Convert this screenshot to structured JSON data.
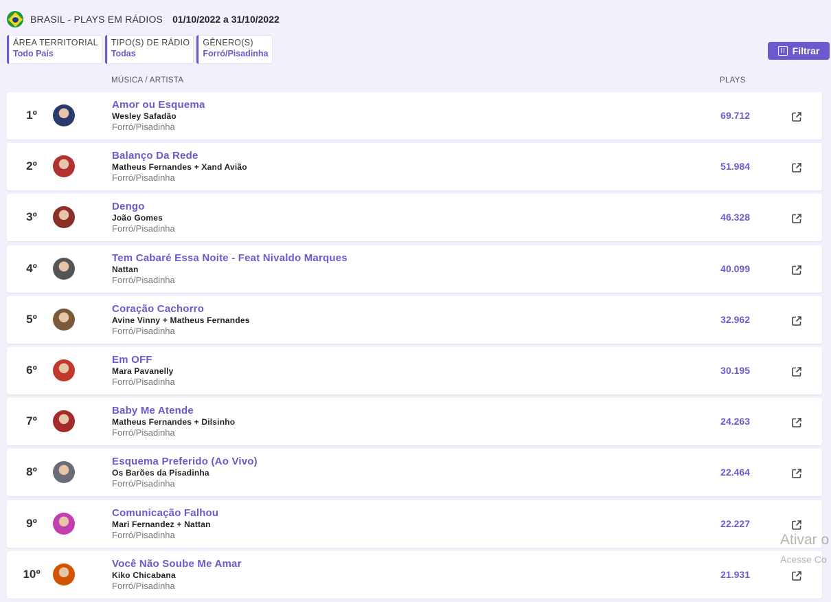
{
  "header": {
    "title": "BRASIL - PLAYS EM RÁDIOS",
    "date_range": "01/10/2022 a 31/10/2022",
    "flag_icon": "brazil-flag-icon"
  },
  "filters": [
    {
      "label": "ÁREA TERRITORIAL",
      "value": "Todo País"
    },
    {
      "label": "TIPO(S) DE RÁDIO",
      "value": "Todas"
    },
    {
      "label": "GÊNERO(S)",
      "value": "Forró/Pisadinha"
    }
  ],
  "filter_button": {
    "label": "Filtrar",
    "icon": "filter-icon"
  },
  "columns": {
    "music": "MÚSICA / ARTISTA",
    "plays": "PLAYS"
  },
  "colors": {
    "accent": "#6a5acd",
    "background": "#f3f0fb"
  },
  "rows": [
    {
      "rank": "1º",
      "song": "Amor ou Esquema",
      "artist": "Wesley Safadão",
      "genre": "Forró/Pisadinha",
      "plays": "69.712",
      "avatar_color": "#2a3a6b"
    },
    {
      "rank": "2º",
      "song": "Balanço Da Rede",
      "artist": "Matheus Fernandes + Xand Avião",
      "genre": "Forró/Pisadinha",
      "plays": "51.984",
      "avatar_color": "#b33030"
    },
    {
      "rank": "3º",
      "song": "Dengo",
      "artist": "João Gomes",
      "genre": "Forró/Pisadinha",
      "plays": "46.328",
      "avatar_color": "#8a2f2a"
    },
    {
      "rank": "4º",
      "song": "Tem Cabaré Essa Noite - Feat Nivaldo Marques",
      "artist": "Nattan",
      "genre": "Forró/Pisadinha",
      "plays": "40.099",
      "avatar_color": "#555555"
    },
    {
      "rank": "5º",
      "song": "Coração Cachorro",
      "artist": "Avine Vinny + Matheus Fernandes",
      "genre": "Forró/Pisadinha",
      "plays": "32.962",
      "avatar_color": "#7a5a3a"
    },
    {
      "rank": "6º",
      "song": "Em OFF",
      "artist": "Mara Pavanelly",
      "genre": "Forró/Pisadinha",
      "plays": "30.195",
      "avatar_color": "#c0392b"
    },
    {
      "rank": "7º",
      "song": "Baby Me Atende",
      "artist": "Matheus Fernandes + Dilsinho",
      "genre": "Forró/Pisadinha",
      "plays": "24.263",
      "avatar_color": "#a52a2a"
    },
    {
      "rank": "8º",
      "song": "Esquema Preferido (Ao Vivo)",
      "artist": "Os Barões da Pisadinha",
      "genre": "Forró/Pisadinha",
      "plays": "22.464",
      "avatar_color": "#6b6b7a"
    },
    {
      "rank": "9º",
      "song": "Comunicação Falhou",
      "artist": "Mari Fernandez + Nattan",
      "genre": "Forró/Pisadinha",
      "plays": "22.227",
      "avatar_color": "#c23fb0"
    },
    {
      "rank": "10º",
      "song": "Você Não Soube Me Amar",
      "artist": "Kiko Chicabana",
      "genre": "Forró/Pisadinha",
      "plays": "21.931",
      "avatar_color": "#d35400"
    }
  ],
  "watermark": {
    "line1": "Ativar o",
    "line2": "Acesse Co"
  }
}
